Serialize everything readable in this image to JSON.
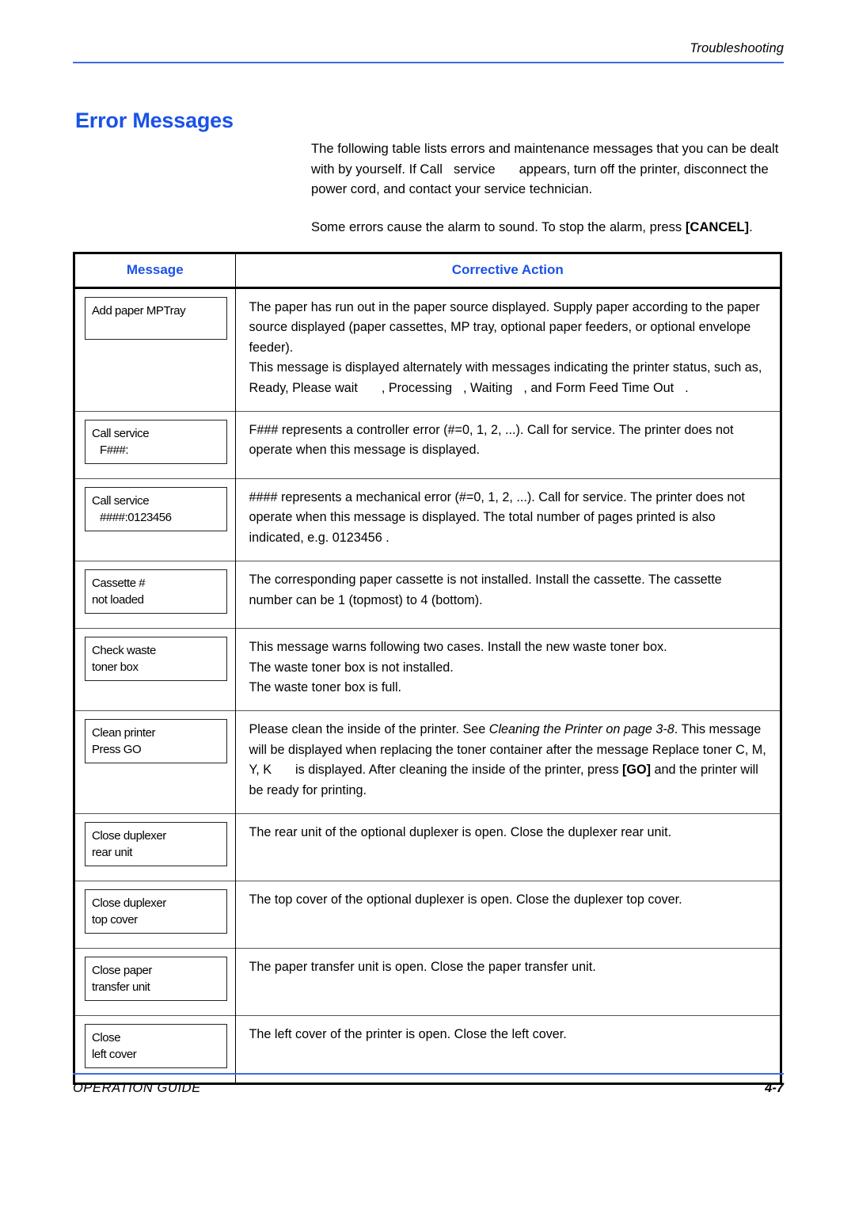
{
  "header": {
    "running_head": "Troubleshooting",
    "rule_color": "#4169E1"
  },
  "section": {
    "title": "Error Messages",
    "title_color": "#1A52E8"
  },
  "intro": {
    "para1_part1": "The following table lists errors and maintenance messages that you can be dealt with by yourself. If Call",
    "para1_part2": "service",
    "para1_part3": "appears, turn off the printer, disconnect the power cord, and contact your service technician.",
    "para2_part1": "Some errors cause the alarm to sound. To stop the alarm, press",
    "para2_cancel": "[CANCEL]",
    "para2_end": "."
  },
  "table": {
    "headers": {
      "message": "Message",
      "corrective_action": "Corrective Action"
    },
    "rows": [
      {
        "lcd_line1": "Add paper MPTray",
        "lcd_line2": "",
        "action_lines": [
          "The paper has run out in the paper source displayed. Supply paper according to the paper source displayed (paper cassettes, MP tray, optional paper feeders, or optional envelope feeder).",
          "This message is displayed alternately with messages indicating the printer status, such as, Ready, Please wait",
          ", Processing",
          ", Waiting",
          ", and Form Feed Time Out",
          "."
        ]
      },
      {
        "lcd_line1": "Call service",
        "lcd_line2": "F###:",
        "action_lines": [
          "F###  represents a controller error (#=0, 1, 2, ...). Call for service. The printer does not operate when this message is displayed."
        ]
      },
      {
        "lcd_line1": "Call service",
        "lcd_line2": "####:0123456",
        "action_lines": [
          "####  represents a mechanical error (#=0, 1, 2, ...). Call for service. The printer does not operate when this message is displayed. The total number of pages printed is also indicated, e.g. 0123456 ."
        ]
      },
      {
        "lcd_line1": "Cassette #",
        "lcd_line2": "not loaded",
        "action_lines": [
          "The corresponding paper cassette is not installed. Install the cassette. The cassette number can be 1 (topmost) to 4 (bottom)."
        ]
      },
      {
        "lcd_line1": "Check waste",
        "lcd_line2": "toner box",
        "action_lines": [
          "This message warns following two cases. Install the new waste toner box.",
          "The waste toner box is not installed.",
          "The waste toner box is full."
        ]
      },
      {
        "lcd_line1": "Clean printer",
        "lcd_line2": "Press GO",
        "action_clean": {
          "seg1": "Please clean the inside of the printer. See ",
          "seg2_italic": "Cleaning the Printer on page 3-8",
          "seg3": ".",
          "seg4": "This message will be displayed when replacing the toner container after the message Replace toner C, M, Y, K",
          "seg5": "is displayed. After cleaning the inside of the printer, press ",
          "seg6_bold": "[GO]",
          "seg7": " and the printer will be ready for printing."
        }
      },
      {
        "lcd_line1": "Close duplexer",
        "lcd_line2": "rear unit",
        "action_lines": [
          "The rear unit of the optional duplexer is open. Close the duplexer rear unit."
        ]
      },
      {
        "lcd_line1": "Close duplexer",
        "lcd_line2": "top cover",
        "action_lines": [
          "The top cover of the optional duplexer is open. Close the duplexer top cover."
        ]
      },
      {
        "lcd_line1": "Close paper",
        "lcd_line2": "transfer unit",
        "action_lines": [
          "The paper transfer unit is open. Close the paper transfer unit."
        ]
      },
      {
        "lcd_line1": "Close",
        "lcd_line2": "left cover",
        "action_lines": [
          "The left cover of the printer is open. Close the left cover."
        ]
      }
    ]
  },
  "footer": {
    "left": "OPERATION GUIDE",
    "right": "4-7",
    "rule_color": "#4169E1"
  }
}
